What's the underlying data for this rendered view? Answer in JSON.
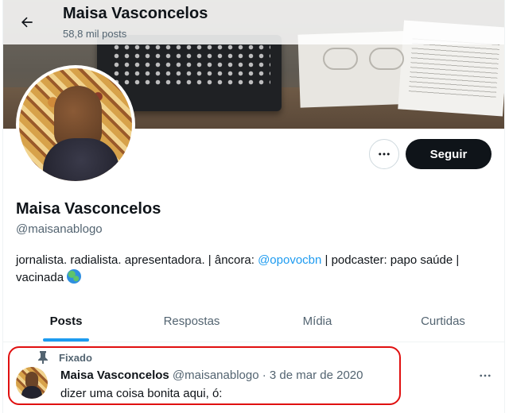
{
  "header": {
    "title": "Maisa Vasconcelos",
    "post_count": "58,8 mil posts"
  },
  "profile": {
    "name": "Maisa Vasconcelos",
    "handle": "@maisanablogo",
    "bio_before": "jornalista. radialista. apresentadora. | âncora: ",
    "bio_mention": "@opovocbn",
    "bio_after": " | podcaster: papo saúde | vacinada ",
    "bio_emoji": "globe-emoji"
  },
  "actions": {
    "follow_label": "Seguir",
    "more_icon": "more-horizontal-icon"
  },
  "tabs": [
    {
      "label": "Posts",
      "active": true
    },
    {
      "label": "Respostas",
      "active": false
    },
    {
      "label": "Mídia",
      "active": false
    },
    {
      "label": "Curtidas",
      "active": false
    }
  ],
  "pinned_post": {
    "pin_label": "Fixado",
    "author_name": "Maisa Vasconcelos",
    "author_handle": "@maisanablogo",
    "separator": "·",
    "date": "3 de mar de 2020",
    "text": "dizer uma coisa bonita aqui, ó:"
  },
  "colors": {
    "accent": "#1d9bf0",
    "text_primary": "#0f1419",
    "text_secondary": "#536471",
    "follow_button": "#0f1419",
    "highlight_box": "#e01010"
  }
}
